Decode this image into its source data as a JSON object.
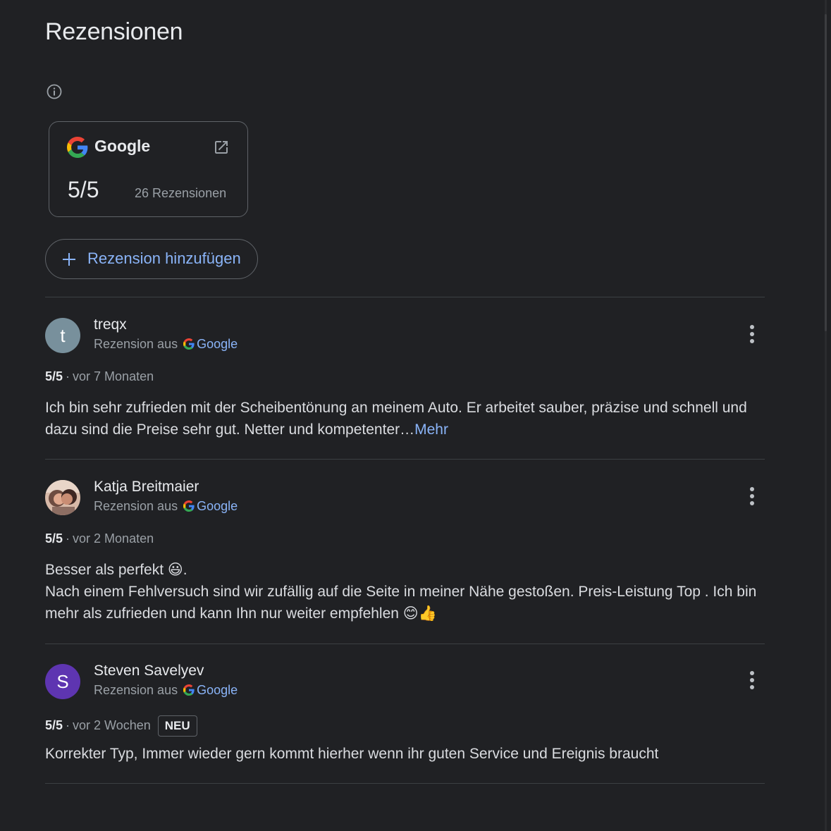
{
  "page": {
    "title": "Rezensionen"
  },
  "source_card": {
    "name": "Google",
    "rating": "5/5",
    "count": "26 Rezensionen"
  },
  "add_review": {
    "label": "Rezension hinzufügen"
  },
  "reviews": [
    {
      "author": "treqx",
      "avatar_letter": "t",
      "avatar_color": "#78909c",
      "source_prefix": "Rezension aus",
      "source_name": "Google",
      "score": "5/5",
      "time": "vor 7 Monaten",
      "badge": "",
      "text_lines": [
        "Ich bin sehr zufrieden mit der Scheibentönung an meinem Auto. Er arbeitet sauber, präzise und schnell und dazu sind die Preise sehr gut. Netter und kompetenter…"
      ],
      "more_label": "Mehr"
    },
    {
      "author": "Katja Breitmaier",
      "avatar_letter": "",
      "avatar_color": "#8d6e63",
      "source_prefix": "Rezension aus",
      "source_name": "Google",
      "score": "5/5",
      "time": "vor 2 Monaten",
      "badge": "",
      "text_lines": [
        "Besser als perfekt 😃.",
        "Nach einem Fehlversuch sind wir zufällig auf die Seite in meiner Nähe gestoßen. Preis-Leistung Top . Ich bin mehr als zufrieden und kann Ihn nur weiter empfehlen 😊👍"
      ],
      "more_label": ""
    },
    {
      "author": "Steven Savelyev",
      "avatar_letter": "S",
      "avatar_color": "#5e35b1",
      "source_prefix": "Rezension aus",
      "source_name": "Google",
      "score": "5/5",
      "time": "vor 2 Wochen",
      "badge": "NEU",
      "text_lines": [
        "Korrekter Typ, Immer wieder gern kommt hierher wenn ihr guten Service und Ereignis braucht"
      ],
      "more_label": ""
    }
  ],
  "icons": {
    "info": "info-icon",
    "external": "open-in-new-icon",
    "add": "plus-icon",
    "more": "more-vert-icon",
    "google": "google-g-icon"
  },
  "colors": {
    "background": "#202124",
    "link": "#8ab4f8",
    "text": "#e8eaed",
    "muted": "#9aa0a6"
  }
}
